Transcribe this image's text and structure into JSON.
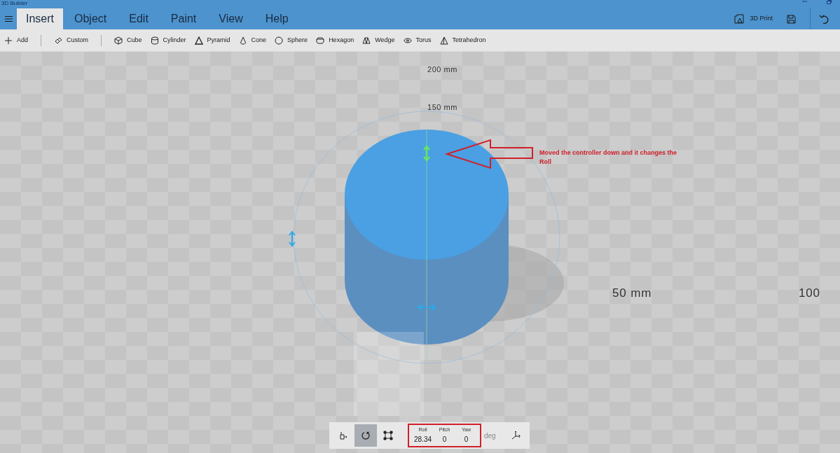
{
  "window": {
    "title": "3D Builder"
  },
  "menu_tabs": [
    {
      "label": "Insert",
      "selected": true
    },
    {
      "label": "Object",
      "selected": false
    },
    {
      "label": "Edit",
      "selected": false
    },
    {
      "label": "Paint",
      "selected": false
    },
    {
      "label": "View",
      "selected": false
    },
    {
      "label": "Help",
      "selected": false
    }
  ],
  "header_actions": [
    {
      "kind": "print",
      "label": "3D Print"
    },
    {
      "kind": "save"
    },
    {
      "kind": "undo"
    }
  ],
  "toolbar": [
    {
      "kind": "add",
      "label": "Add"
    },
    {
      "kind": "custom",
      "label": "Custom"
    },
    {
      "kind": "cube",
      "label": "Cube"
    },
    {
      "kind": "cylinder",
      "label": "Cylinder"
    },
    {
      "kind": "pyramid",
      "label": "Pyramid"
    },
    {
      "kind": "cone",
      "label": "Cone"
    },
    {
      "kind": "sphere",
      "label": "Sphere"
    },
    {
      "kind": "hexagon",
      "label": "Hexagon"
    },
    {
      "kind": "wedge",
      "label": "Wedge"
    },
    {
      "kind": "torus",
      "label": "Torus"
    },
    {
      "kind": "tetrahedron",
      "label": "Tetrahedron"
    }
  ],
  "viewport": {
    "scale_labels": [
      "200 mm",
      "150 mm",
      "50 mm",
      "100"
    ],
    "annotation": "Moved the controller down and it changes the Roll"
  },
  "transform_bar": {
    "modes": [
      {
        "kind": "move",
        "selected": false
      },
      {
        "kind": "rotate",
        "selected": true
      },
      {
        "kind": "scale",
        "selected": false
      }
    ],
    "fields": [
      {
        "label": "Roll",
        "value": "28.34"
      },
      {
        "label": "Pitch",
        "value": "0"
      },
      {
        "label": "Yaw",
        "value": "0"
      }
    ],
    "unit": "deg",
    "end_action": {
      "kind": "axes"
    }
  }
}
